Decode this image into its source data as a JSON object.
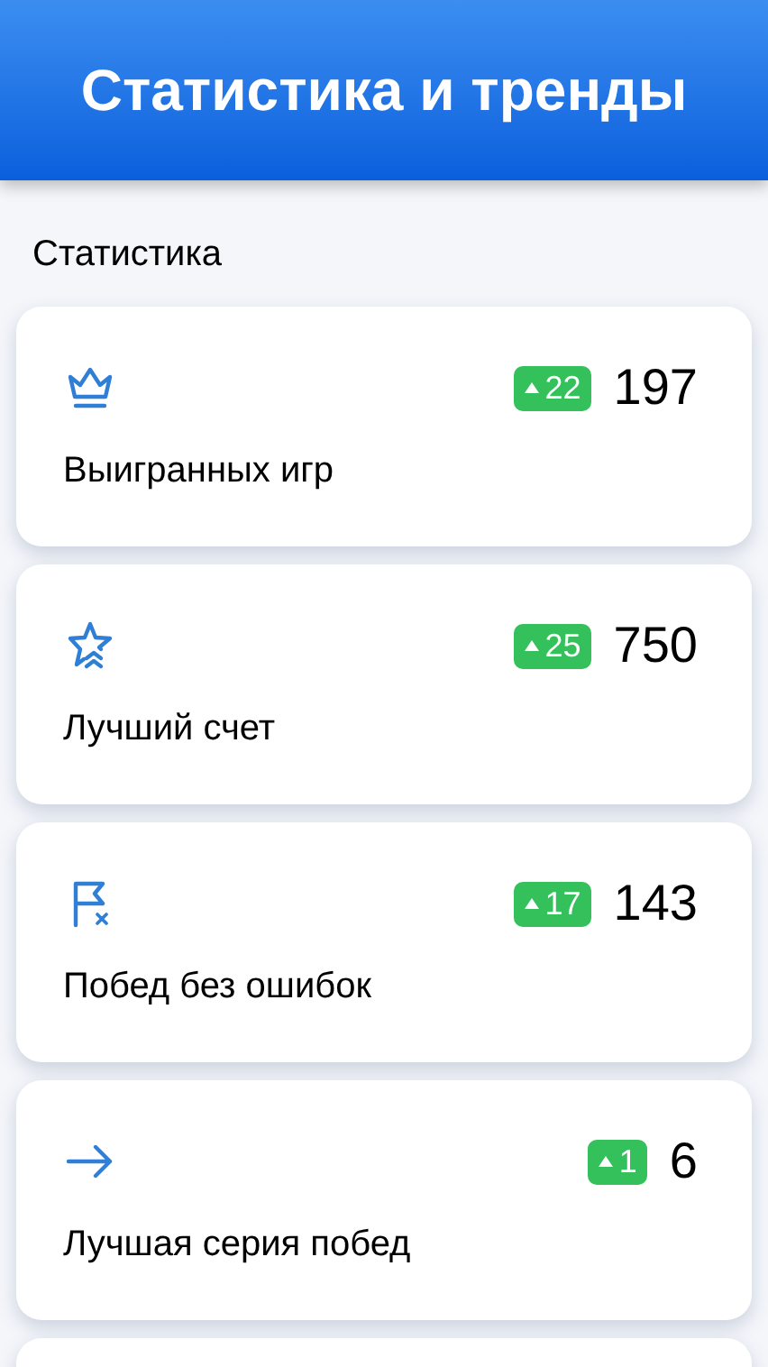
{
  "header": {
    "title": "Статистика и тренды"
  },
  "section": {
    "title": "Статистика"
  },
  "stats": [
    {
      "label": "Выигранных игр",
      "change": "22",
      "value": "197"
    },
    {
      "label": "Лучший счет",
      "change": "25",
      "value": "750"
    },
    {
      "label": "Побед без ошибок",
      "change": "17",
      "value": "143"
    },
    {
      "label": "Лучшая серия побед",
      "change": "1",
      "value": "6"
    }
  ]
}
